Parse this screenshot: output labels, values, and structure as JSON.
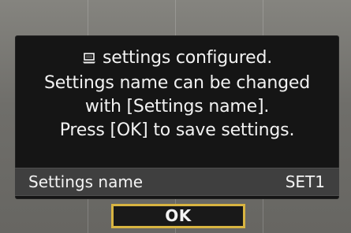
{
  "dialog": {
    "message_lines": [
      "settings configured.",
      "Settings name can be changed",
      "with [Settings name].",
      "Press [OK] to save settings."
    ],
    "icon": "laptop-icon"
  },
  "settings": {
    "label": "Settings name",
    "value": "SET1"
  },
  "button": {
    "label": "OK",
    "accent_color": "#d8b441"
  },
  "colors": {
    "background": "#6e6d69",
    "dialog": "#151515",
    "text": "#f2f2f2",
    "row": "#3f3f3f"
  }
}
